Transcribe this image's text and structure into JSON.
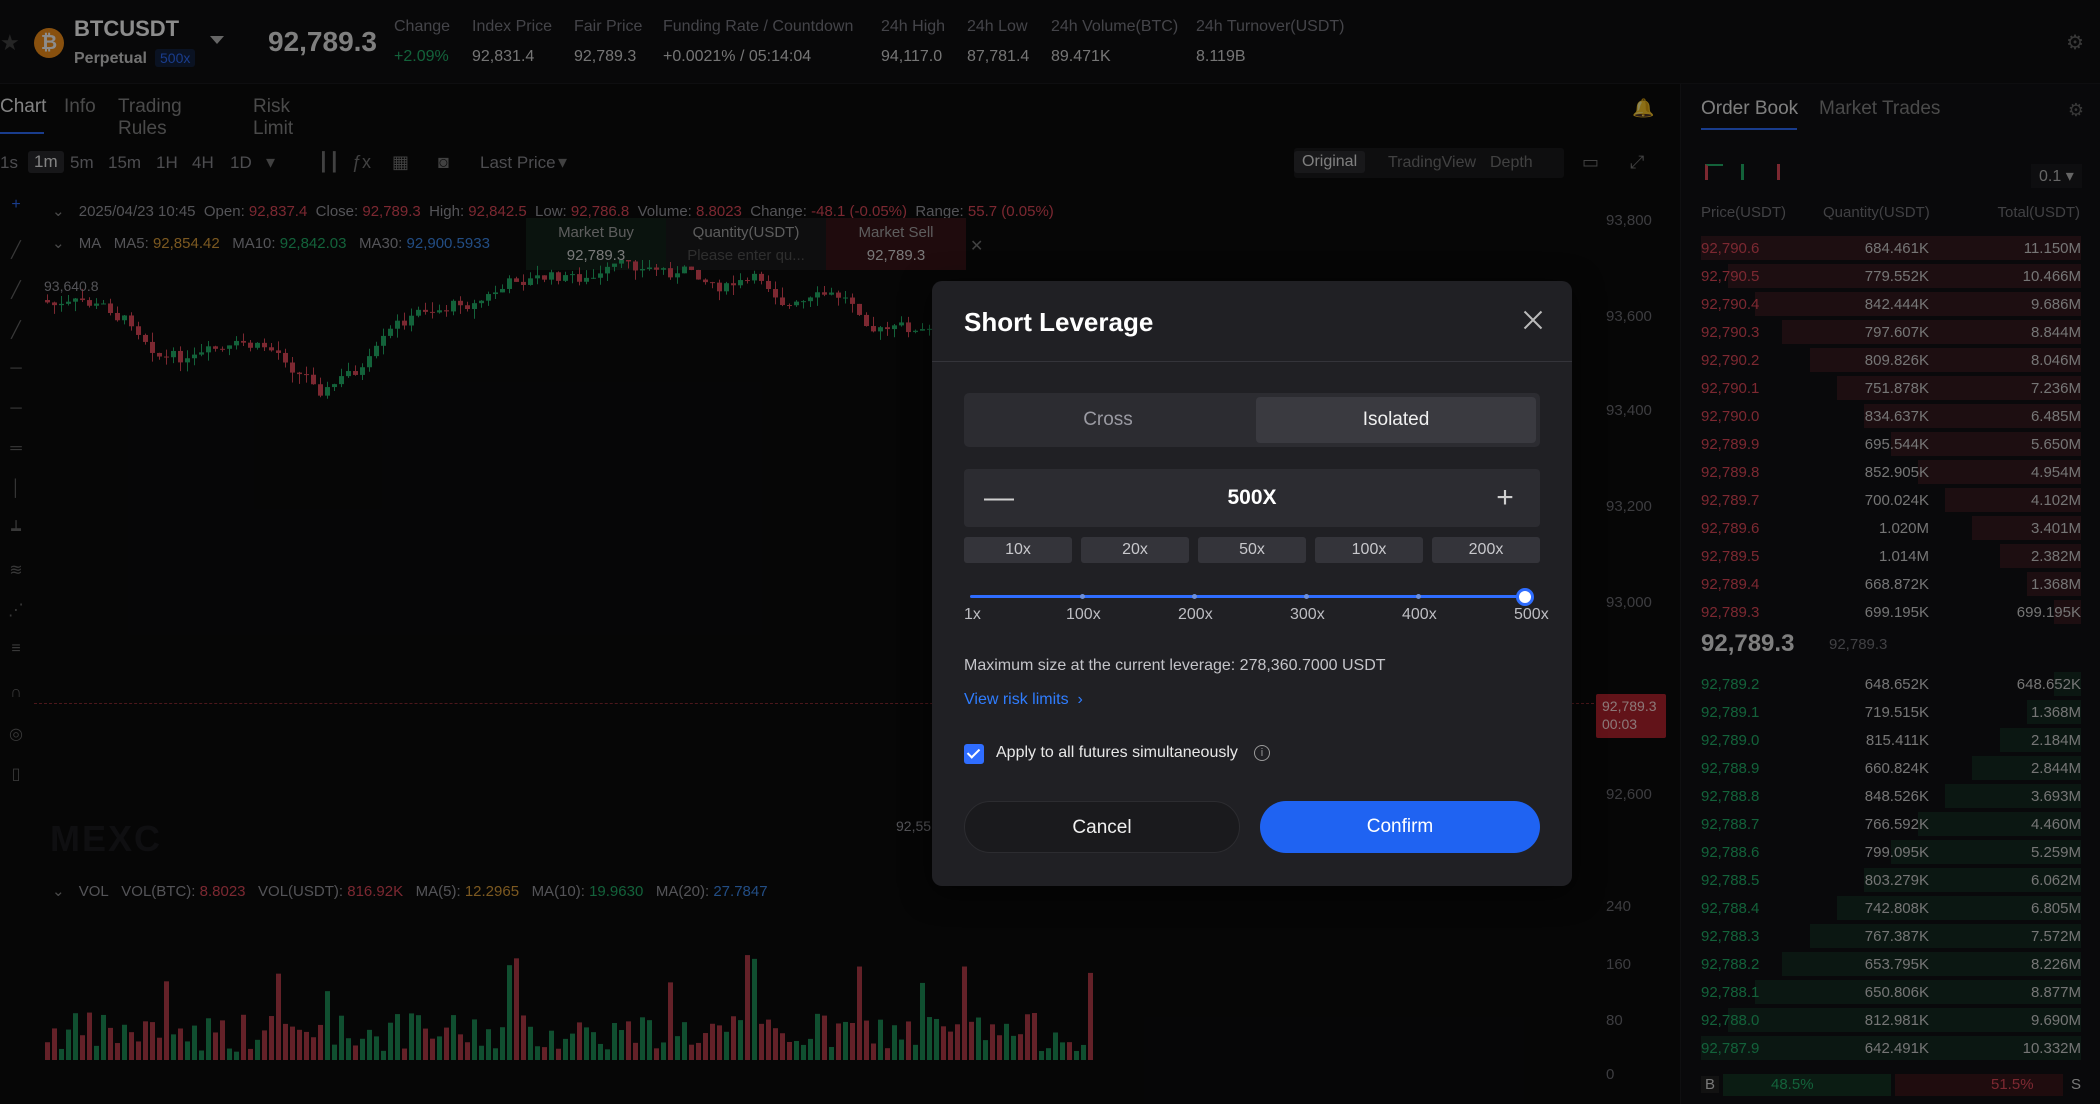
{
  "header": {
    "symbol": "BTCUSDT",
    "contract": "Perpetual",
    "max_leverage": "500x",
    "last_price": "92,789.3",
    "stats": [
      {
        "label": "Change",
        "value": "+2.09%"
      },
      {
        "label": "Index Price",
        "value": "92,831.4"
      },
      {
        "label": "Fair Price",
        "value": "92,789.3"
      },
      {
        "label": "Funding Rate / Countdown",
        "value": "+0.0021%  /  05:14:04"
      },
      {
        "label": "24h High",
        "value": "94,117.0"
      },
      {
        "label": "24h Low",
        "value": "87,781.4"
      },
      {
        "label": "24h Volume(BTC)",
        "value": "89.471K"
      },
      {
        "label": "24h Turnover(USDT)",
        "value": "8.119B"
      }
    ]
  },
  "chart_tabs": [
    "Chart",
    "Info",
    "Trading Rules",
    "Risk Limit"
  ],
  "toolbar": {
    "timeframes": [
      "1s",
      "1m",
      "5m",
      "15m",
      "1H",
      "4H",
      "1D"
    ],
    "active_timeframe": "1m",
    "price_type": "Last Price",
    "views": [
      "Original",
      "TradingView",
      "Depth"
    ],
    "active_view": "Original"
  },
  "chart_info": {
    "date": "2025/04/23 10:45",
    "open_label": "Open:",
    "open": "92,837.4",
    "close_label": "Close:",
    "close": "92,789.3",
    "high_label": "High:",
    "high": "92,842.5",
    "low_label": "Low:",
    "low": "92,786.8",
    "volume_label": "Volume:",
    "volume": "8.8023",
    "change_label": "Change:",
    "change": "-48.1 (-0.05%)",
    "range_label": "Range:",
    "range": "55.7 (0.05%)",
    "ma_label": "MA",
    "ma5_label": "MA5:",
    "ma5": "92,854.42",
    "ma10_label": "MA10:",
    "ma10": "92,842.03",
    "ma30_label": "MA30:",
    "ma30": "92,900.5933",
    "high_marker": "93,640.8",
    "low_marker": "92,55",
    "watermark": "MEXC"
  },
  "quick_trade": {
    "buy_label": "Market Buy",
    "buy_price": "92,789.3",
    "qty_label": "Quantity(USDT)",
    "qty_placeholder": "Please enter qu...",
    "sell_label": "Market Sell",
    "sell_price": "92,789.3"
  },
  "y_axis": [
    "93,800",
    "93,600",
    "93,400",
    "93,200",
    "93,000",
    "92,600"
  ],
  "price_tag": {
    "price": "92,789.3",
    "countdown": "00:03"
  },
  "vol_info": {
    "label": "VOL",
    "vol_btc_label": "VOL(BTC):",
    "vol_btc": "8.8023",
    "vol_usdt_label": "VOL(USDT):",
    "vol_usdt": "816.92K",
    "ma5_label": "MA(5):",
    "ma5": "12.2965",
    "ma10_label": "MA(10):",
    "ma10": "19.9630",
    "ma20_label": "MA(20):",
    "ma20": "27.7847"
  },
  "vol_axis": [
    "240",
    "160",
    "80",
    "0"
  ],
  "order_book": {
    "tabs": [
      "Order Book",
      "Market Trades"
    ],
    "precision": "0.1",
    "headers": [
      "Price(USDT)",
      "Quantity(USDT)",
      "Total(USDT)"
    ],
    "asks": [
      {
        "price": "92,790.6",
        "qty": "684.461K",
        "total": "11.150M"
      },
      {
        "price": "92,790.5",
        "qty": "779.552K",
        "total": "10.466M"
      },
      {
        "price": "92,790.4",
        "qty": "842.444K",
        "total": "9.686M"
      },
      {
        "price": "92,790.3",
        "qty": "797.607K",
        "total": "8.844M"
      },
      {
        "price": "92,790.2",
        "qty": "809.826K",
        "total": "8.046M"
      },
      {
        "price": "92,790.1",
        "qty": "751.878K",
        "total": "7.236M"
      },
      {
        "price": "92,790.0",
        "qty": "834.637K",
        "total": "6.485M"
      },
      {
        "price": "92,789.9",
        "qty": "695.544K",
        "total": "5.650M"
      },
      {
        "price": "92,789.8",
        "qty": "852.905K",
        "total": "4.954M"
      },
      {
        "price": "92,789.7",
        "qty": "700.024K",
        "total": "4.102M"
      },
      {
        "price": "92,789.6",
        "qty": "1.020M",
        "total": "3.401M"
      },
      {
        "price": "92,789.5",
        "qty": "1.014M",
        "total": "2.382M"
      },
      {
        "price": "92,789.4",
        "qty": "668.872K",
        "total": "1.368M"
      },
      {
        "price": "92,789.3",
        "qty": "699.195K",
        "total": "699.195K"
      }
    ],
    "mid_price": "92,789.3",
    "mid_fair": "92,789.3",
    "bids": [
      {
        "price": "92,789.2",
        "qty": "648.652K",
        "total": "648.652K"
      },
      {
        "price": "92,789.1",
        "qty": "719.515K",
        "total": "1.368M"
      },
      {
        "price": "92,789.0",
        "qty": "815.411K",
        "total": "2.184M"
      },
      {
        "price": "92,788.9",
        "qty": "660.824K",
        "total": "2.844M"
      },
      {
        "price": "92,788.8",
        "qty": "848.526K",
        "total": "3.693M"
      },
      {
        "price": "92,788.7",
        "qty": "766.592K",
        "total": "4.460M"
      },
      {
        "price": "92,788.6",
        "qty": "799.095K",
        "total": "5.259M"
      },
      {
        "price": "92,788.5",
        "qty": "803.279K",
        "total": "6.062M"
      },
      {
        "price": "92,788.4",
        "qty": "742.808K",
        "total": "6.805M"
      },
      {
        "price": "92,788.3",
        "qty": "767.387K",
        "total": "7.572M"
      },
      {
        "price": "92,788.2",
        "qty": "653.795K",
        "total": "8.226M"
      },
      {
        "price": "92,788.1",
        "qty": "650.806K",
        "total": "8.877M"
      },
      {
        "price": "92,788.0",
        "qty": "812.981K",
        "total": "9.690M"
      },
      {
        "price": "92,787.9",
        "qty": "642.491K",
        "total": "10.332M"
      }
    ],
    "buy_ratio_label": "B",
    "buy_ratio": "48.5%",
    "sell_ratio": "51.5%",
    "sell_ratio_label": "S"
  },
  "modal": {
    "title": "Short Leverage",
    "modes": [
      "Cross",
      "Isolated"
    ],
    "selected_mode": "Isolated",
    "leverage_value": "500X",
    "presets": [
      "10x",
      "20x",
      "50x",
      "100x",
      "200x"
    ],
    "slider_labels": [
      "1x",
      "100x",
      "200x",
      "300x",
      "400x",
      "500x"
    ],
    "slider_fraction": 1.0,
    "max_size_text": "Maximum size at the current leverage: 278,360.7000 USDT",
    "risk_link": "View risk limits",
    "apply_all_label": "Apply to all futures simultaneously",
    "apply_all_checked": true,
    "cancel_label": "Cancel",
    "confirm_label": "Confirm"
  },
  "colors": {
    "accent": "#1f63f2",
    "up": "#23b26b",
    "down": "#e24a5a"
  }
}
